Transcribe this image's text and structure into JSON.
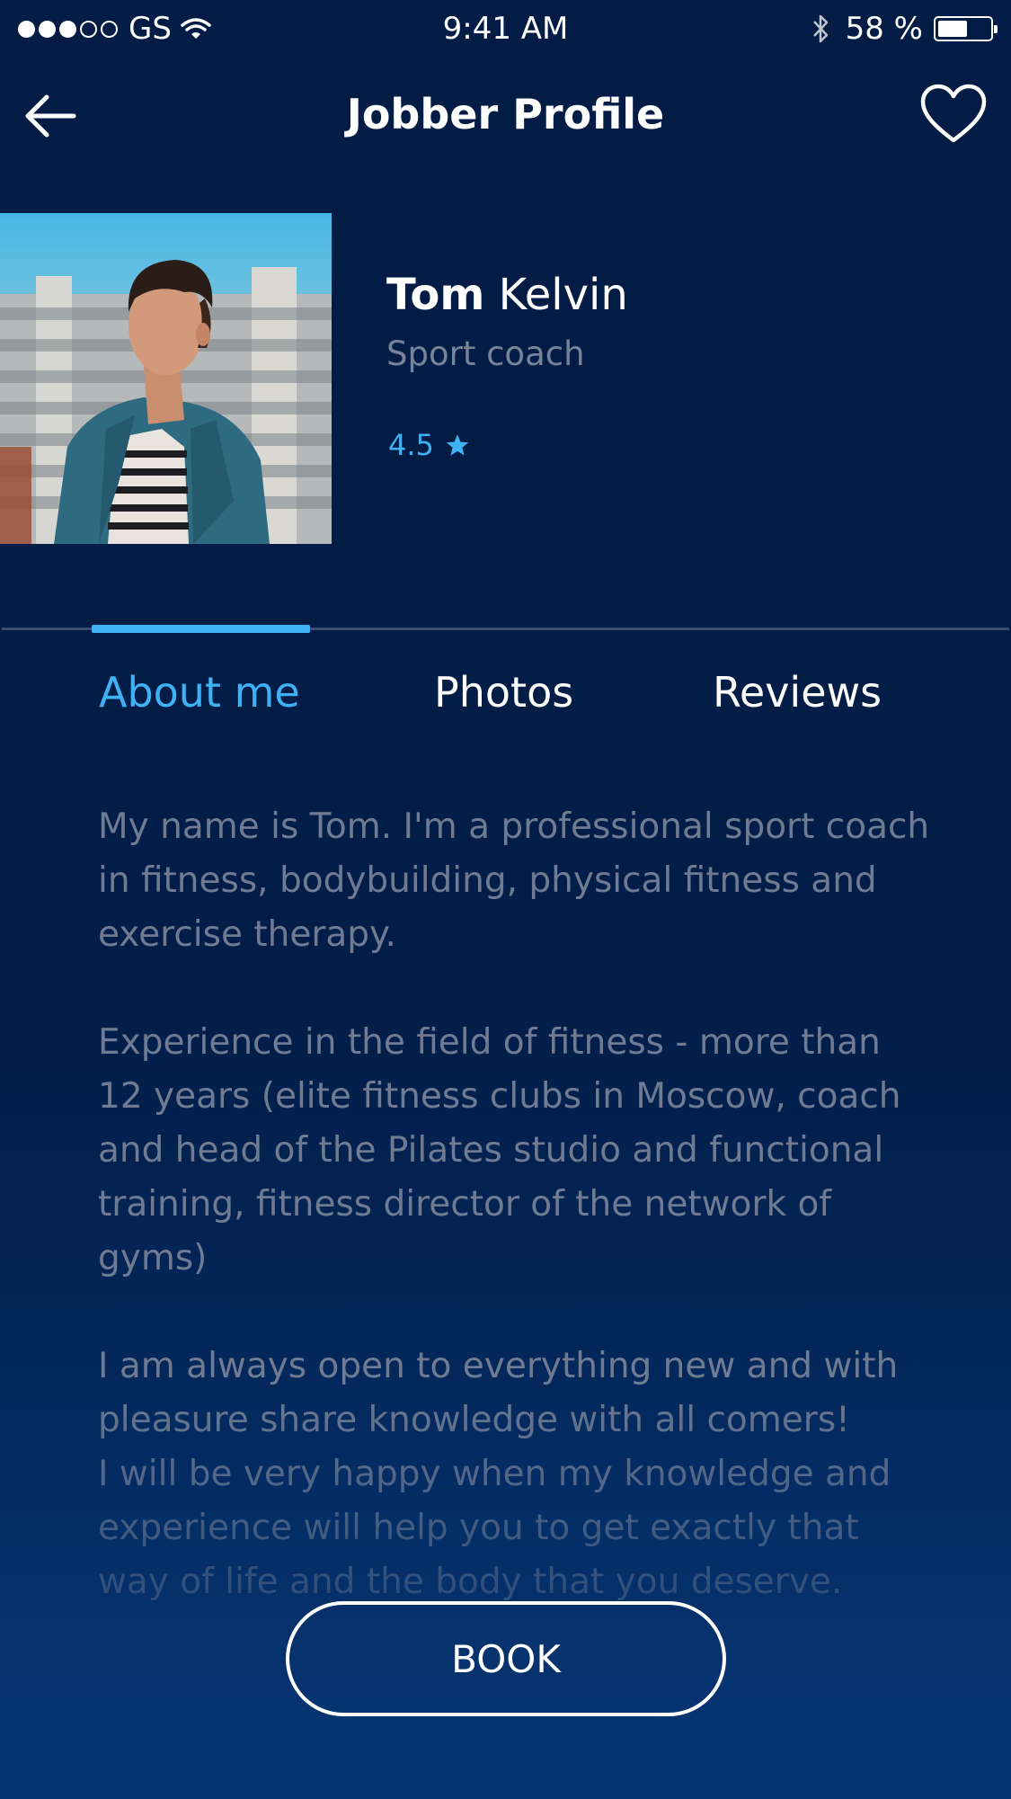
{
  "status_bar": {
    "carrier": "GS",
    "time": "9:41 AM",
    "battery_percent": "58 %",
    "battery_level": 0.58,
    "signal_bars_filled": 3,
    "signal_bars_total": 5
  },
  "nav": {
    "title": "Jobber Profile",
    "back_icon": "arrow-left-icon",
    "favorite_icon": "heart-icon"
  },
  "profile": {
    "first_name": "Tom",
    "last_name": "Kelvin",
    "role": "Sport coach",
    "rating": "4.5",
    "rating_icon": "star-icon"
  },
  "tabs": [
    {
      "label": "About me",
      "active": true
    },
    {
      "label": "Photos",
      "active": false
    },
    {
      "label": "Reviews",
      "active": false
    }
  ],
  "about": {
    "paragraph1": "My name is Tom. I'm a professional sport coach in fitness, bodybuilding, physical fitness and exercise therapy.",
    "paragraph2": "Experience in the field of fitness - more than 12 years (elite fitness clubs in Moscow, coach and head of the Pilates studio and functional training, fitness director of the network of gyms)",
    "paragraph3": "I am always open to everything new and with pleasure share knowledge with all comers!",
    "paragraph4": "I will be very happy when my knowledge and experience will help you to get exactly that way of life and the body that you deserve."
  },
  "actions": {
    "book_label": "BOOK"
  },
  "colors": {
    "background": "#021d47",
    "accent": "#3fb1f5",
    "muted_text": "#6e7b93"
  }
}
